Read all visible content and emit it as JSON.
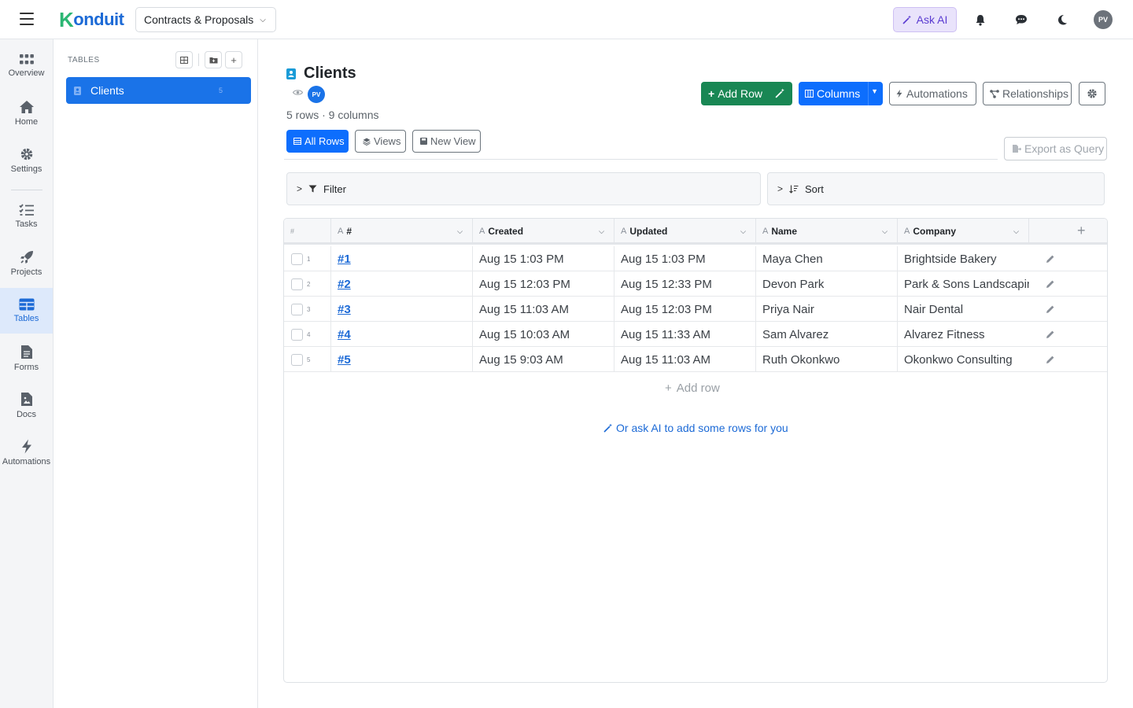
{
  "app": {
    "logo_text": "onduit",
    "logo_k": "K",
    "workspace": "Contracts & Proposals"
  },
  "topbar": {
    "ask_ai": "Ask AI",
    "avatar": "PV"
  },
  "rail": {
    "items": [
      {
        "label": "Overview",
        "icon": "grid-dots-icon"
      },
      {
        "label": "Home",
        "icon": "home-icon"
      },
      {
        "label": "Settings",
        "icon": "gear-icon"
      },
      {
        "label": "Tasks",
        "icon": "checklist-icon"
      },
      {
        "label": "Projects",
        "icon": "rocket-icon"
      },
      {
        "label": "Tables",
        "icon": "table-icon"
      },
      {
        "label": "Forms",
        "icon": "form-icon"
      },
      {
        "label": "Docs",
        "icon": "doc-icon"
      },
      {
        "label": "Automations",
        "icon": "bolt-icon"
      }
    ]
  },
  "tables_panel": {
    "label": "TABLES",
    "items": [
      {
        "name": "Clients",
        "count": "5"
      }
    ]
  },
  "page": {
    "title": "Clients",
    "owner": "PV",
    "meta": "5 rows · 9 columns",
    "buttons": {
      "add_row": "Add Row",
      "columns": "Columns",
      "automations": "Automations",
      "relationships": "Relationships",
      "export": "Export as Query"
    },
    "tabs": {
      "all_rows": "All Rows",
      "views": "Views",
      "new_view": "New View"
    },
    "filter": "Filter",
    "sort": "Sort"
  },
  "grid": {
    "index_header": "#",
    "columns": [
      "#",
      "Created",
      "Updated",
      "Name",
      "Company"
    ],
    "rows": [
      {
        "n": "1",
        "id": "#1",
        "created": "Aug 15 1:03 PM",
        "updated": "Aug 15 1:03 PM",
        "name": "Maya Chen",
        "company": "Brightside Bakery"
      },
      {
        "n": "2",
        "id": "#2",
        "created": "Aug 15 12:03 PM",
        "updated": "Aug 15 12:33 PM",
        "name": "Devon Park",
        "company": "Park & Sons Landscaping"
      },
      {
        "n": "3",
        "id": "#3",
        "created": "Aug 15 11:03 AM",
        "updated": "Aug 15 12:03 PM",
        "name": "Priya Nair",
        "company": "Nair Dental"
      },
      {
        "n": "4",
        "id": "#4",
        "created": "Aug 15 10:03 AM",
        "updated": "Aug 15 11:33 AM",
        "name": "Sam Alvarez",
        "company": "Alvarez Fitness"
      },
      {
        "n": "5",
        "id": "#5",
        "created": "Aug 15 9:03 AM",
        "updated": "Aug 15 11:03 AM",
        "name": "Ruth Okonkwo",
        "company": "Okonkwo Consulting"
      }
    ],
    "add_row": "Add row",
    "ask_ai_rows": "Or ask AI to add some rows for you"
  }
}
